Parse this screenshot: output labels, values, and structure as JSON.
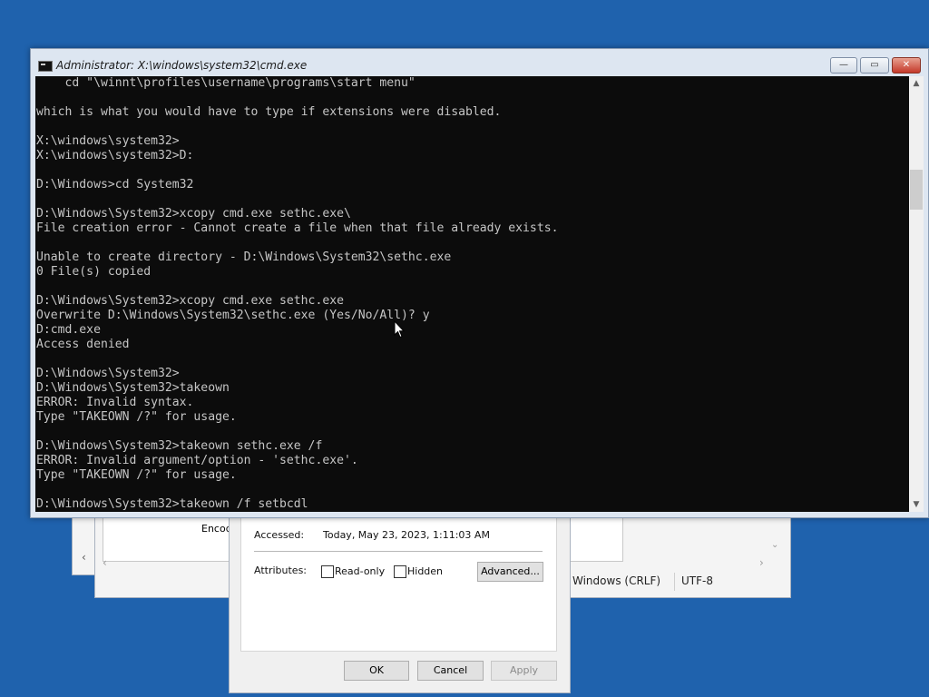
{
  "cmd_window": {
    "title": "Administrator: X:\\windows\\system32\\cmd.exe",
    "controls": {
      "minimize": "—",
      "maximize": "▭",
      "close": "✕"
    },
    "console_lines": [
      "    cd \"\\winnt\\profiles\\username\\programs\\start menu\"",
      "",
      "which is what you would have to type if extensions were disabled.",
      "",
      "X:\\windows\\system32>",
      "X:\\windows\\system32>D:",
      "",
      "D:\\Windows>cd System32",
      "",
      "D:\\Windows\\System32>xcopy cmd.exe sethc.exe\\",
      "File creation error - Cannot create a file when that file already exists.",
      "",
      "Unable to create directory - D:\\Windows\\System32\\sethc.exe",
      "0 File(s) copied",
      "",
      "D:\\Windows\\System32>xcopy cmd.exe sethc.exe",
      "Overwrite D:\\Windows\\System32\\sethc.exe (Yes/No/All)? y",
      "D:cmd.exe",
      "Access denied",
      "",
      "D:\\Windows\\System32>",
      "D:\\Windows\\System32>takeown",
      "ERROR: Invalid syntax.",
      "Type \"TAKEOWN /?\" for usage.",
      "",
      "D:\\Windows\\System32>takeown sethc.exe /f",
      "ERROR: Invalid argument/option - 'sethc.exe'.",
      "Type \"TAKEOWN /?\" for usage.",
      "",
      "D:\\Windows\\System32>takeown /f setbcdl"
    ]
  },
  "notepad_window": {
    "encoding_partial": "Encod",
    "line_ending": "Windows (CRLF)",
    "encoding": "UTF-8"
  },
  "properties_dialog": {
    "accessed_label": "Accessed:",
    "accessed_value": "Today, May 23, 2023, 1:11:03 AM",
    "attributes_label": "Attributes:",
    "readonly_label": "Read-only",
    "hidden_label": "Hidden",
    "advanced_button": "Advanced...",
    "ok_button": "OK",
    "cancel_button": "Cancel",
    "apply_button": "Apply"
  },
  "colors": {
    "desktop": "#1f62ad",
    "console_bg": "#0c0c0c",
    "console_text": "#c6c6c6"
  }
}
